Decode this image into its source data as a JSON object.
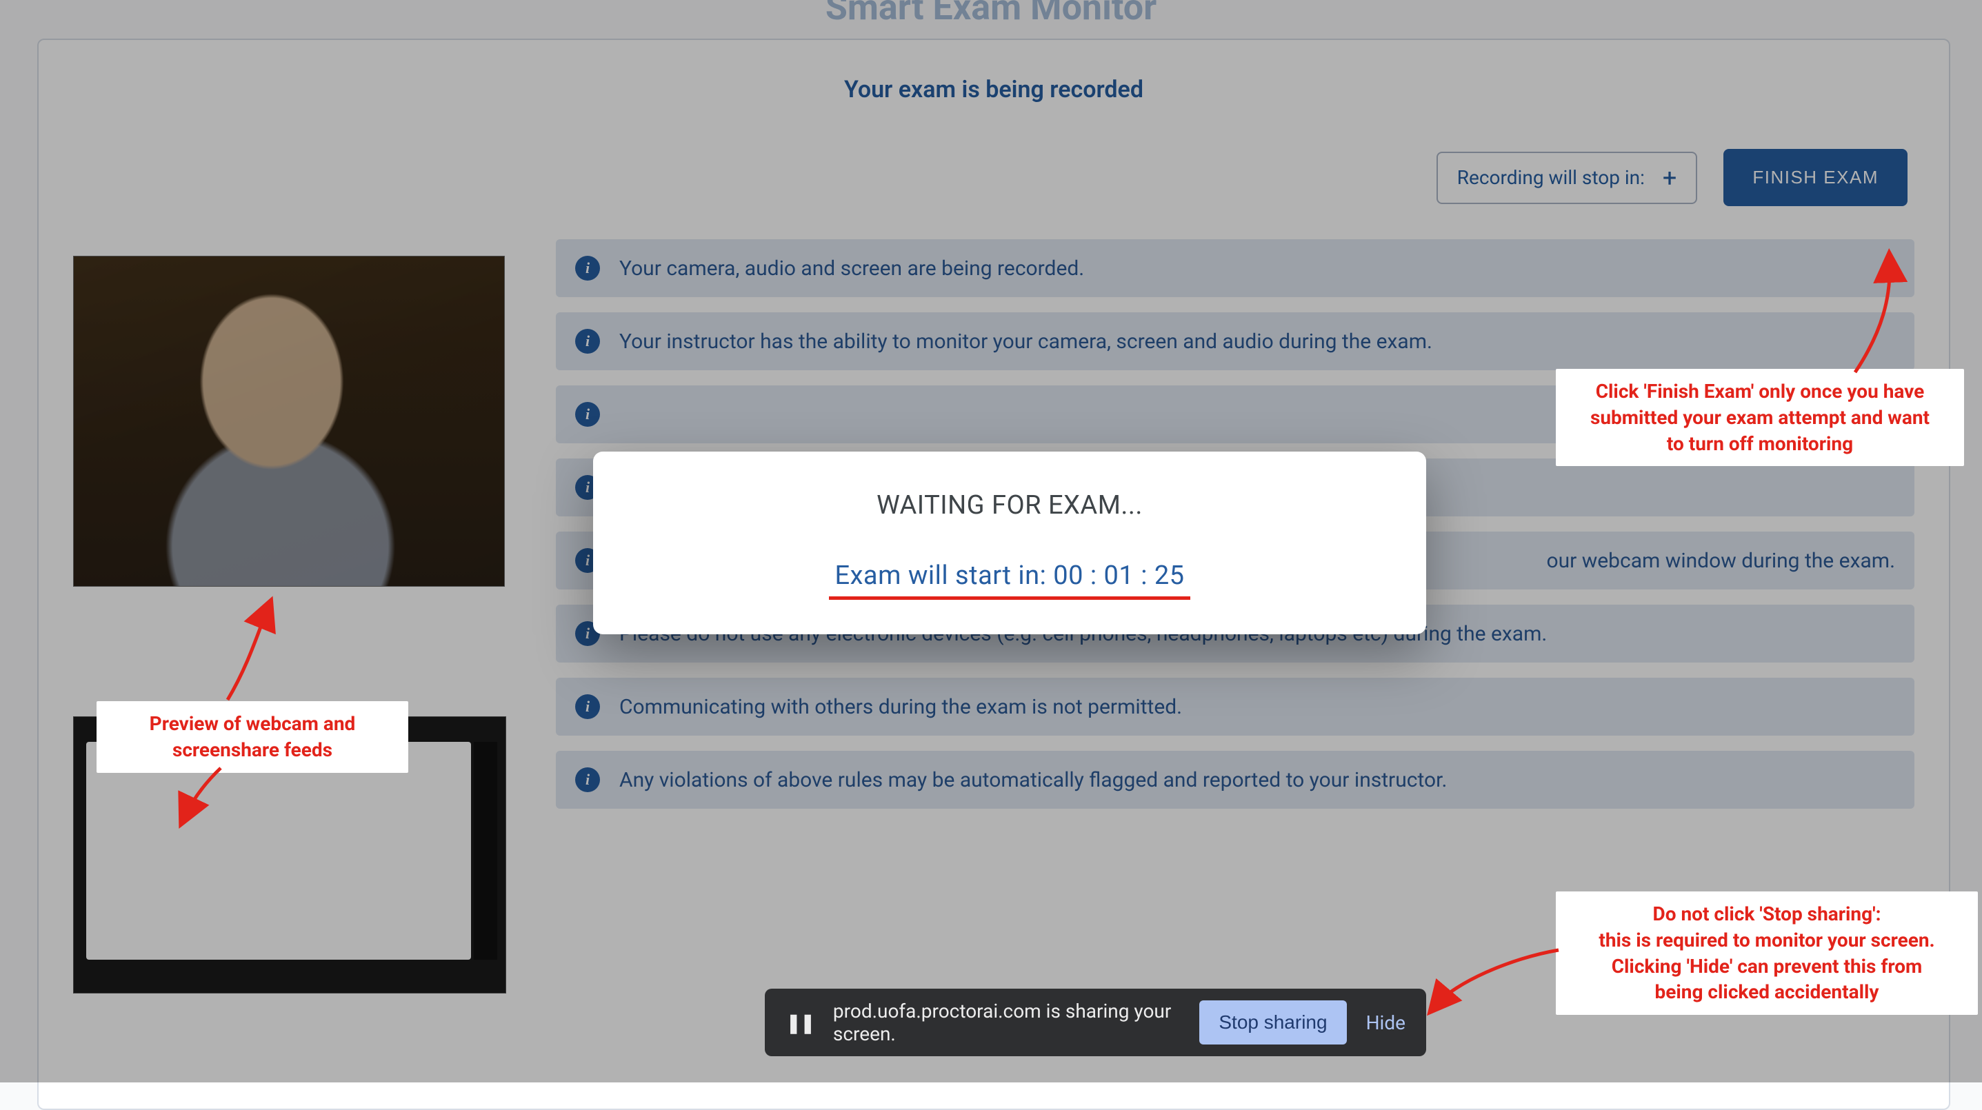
{
  "app_title": "Smart Exam Monitor",
  "subtitle": "Your exam is being recorded",
  "controls": {
    "recording_stop_label": "Recording will stop in:",
    "plus_icon": "+",
    "finish_label": "FINISH EXAM"
  },
  "info_rows": [
    "Your camera, audio and screen are being recorded.",
    "Your instructor has the ability to monitor your camera, screen and audio during the exam.",
    "",
    "",
    "our webcam window during the exam.",
    "Please do not use any electronic devices (e.g. cell phones, headphones, laptops etc) during the exam.",
    "Communicating with others during the exam is not permitted.",
    "Any violations of above rules may be automatically flagged and reported to your instructor."
  ],
  "modal": {
    "waiting_label": "WAITING FOR EXAM...",
    "countdown_prefix": "Exam will start in: ",
    "countdown_value": "00 : 01 : 25"
  },
  "sharebar": {
    "message": "prod.uofa.proctorai.com is sharing your screen.",
    "stop_label": "Stop sharing",
    "hide_label": "Hide"
  },
  "annotations": {
    "webcam_preview": "Preview of webcam and screenshare feeds",
    "finish_note_l1": "Click 'Finish Exam' only once you have",
    "finish_note_l2": "submitted your exam  attempt and want",
    "finish_note_l3": "to turn off monitoring",
    "stop_note_l1": "Do not click 'Stop sharing':",
    "stop_note_l2": "this is required to monitor your screen.",
    "stop_note_l3": "Clicking 'Hide' can prevent this from",
    "stop_note_l4": "being clicked accidentally"
  }
}
